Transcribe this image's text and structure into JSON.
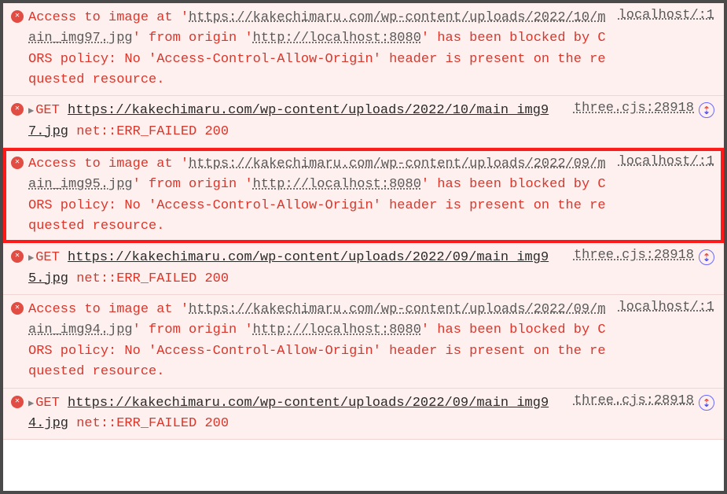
{
  "entries": [
    {
      "type": "cors",
      "highlighted": false,
      "text1": "Access to image at '",
      "url": "https://kakechimaru.com/wp-content/uploads/2022/10/main_img97.jpg",
      "text2": "' from origin '",
      "origin": "http://localhost:8080",
      "text3": "' has been blocked by CORS policy: No 'Access-Control-Allow-Origin' header is present on the requested resource.",
      "source": "localhost/:1"
    },
    {
      "type": "get",
      "highlighted": false,
      "get": "GET",
      "url": "https://kakechimaru.com/wp-content/uploads/2022/10/main_img97.jpg",
      "err": " net::ERR_FAILED 200",
      "source": "three.cjs:28918"
    },
    {
      "type": "cors",
      "highlighted": true,
      "text1": "Access to image at '",
      "url": "https://kakechimaru.com/wp-content/uploads/2022/09/main_img95.jpg",
      "text2": "' from origin '",
      "origin": "http://localhost:8080",
      "text3": "' has been blocked by CORS policy: No 'Access-Control-Allow-Origin' header is present on the requested resource.",
      "source": "localhost/:1"
    },
    {
      "type": "get",
      "highlighted": false,
      "get": "GET",
      "url": "https://kakechimaru.com/wp-content/uploads/2022/09/main_img95.jpg",
      "err": " net::ERR_FAILED 200",
      "source": "three.cjs:28918"
    },
    {
      "type": "cors",
      "highlighted": false,
      "text1": "Access to image at '",
      "url": "https://kakechimaru.com/wp-content/uploads/2022/09/main_img94.jpg",
      "text2": "' from origin '",
      "origin": "http://localhost:8080",
      "text3": "' has been blocked by CORS policy: No 'Access-Control-Allow-Origin' header is present on the requested resource.",
      "source": "localhost/:1"
    },
    {
      "type": "get",
      "highlighted": false,
      "get": "GET",
      "url": "https://kakechimaru.com/wp-content/uploads/2022/09/main_img94.jpg",
      "err": " net::ERR_FAILED 200",
      "source": "three.cjs:28918"
    }
  ]
}
